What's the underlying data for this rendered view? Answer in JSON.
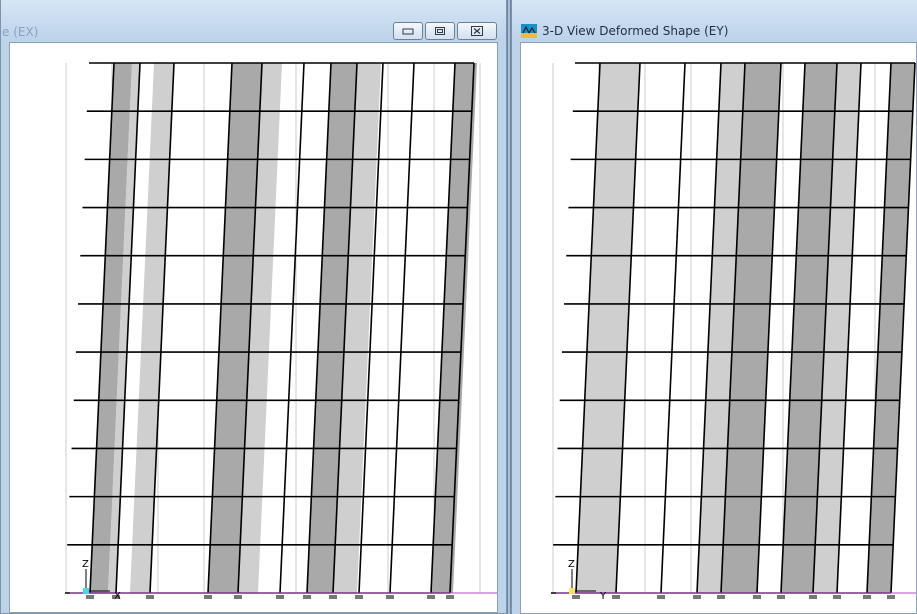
{
  "left_window": {
    "title": "e (EX)",
    "axis_vertical_label": "Z",
    "axis_horizontal_label": "X",
    "controls": {
      "minimize_icon": "minimize-icon",
      "restore_icon": "restore-icon",
      "close_icon": "close-icon"
    }
  },
  "right_window": {
    "title": "3-D View  Deformed Shape (EY)",
    "app_icon": "app-icon",
    "axis_vertical_label": "Z",
    "axis_horizontal_label": "Y"
  },
  "colors": {
    "frame": "#bcd3ea",
    "viewport_bg": "#ffffff",
    "wall_dark": "#a9a9a9",
    "wall_light": "#cfcfcf",
    "grid": "#cccccc",
    "member": "#000000",
    "base_line": "#b04cc8"
  }
}
